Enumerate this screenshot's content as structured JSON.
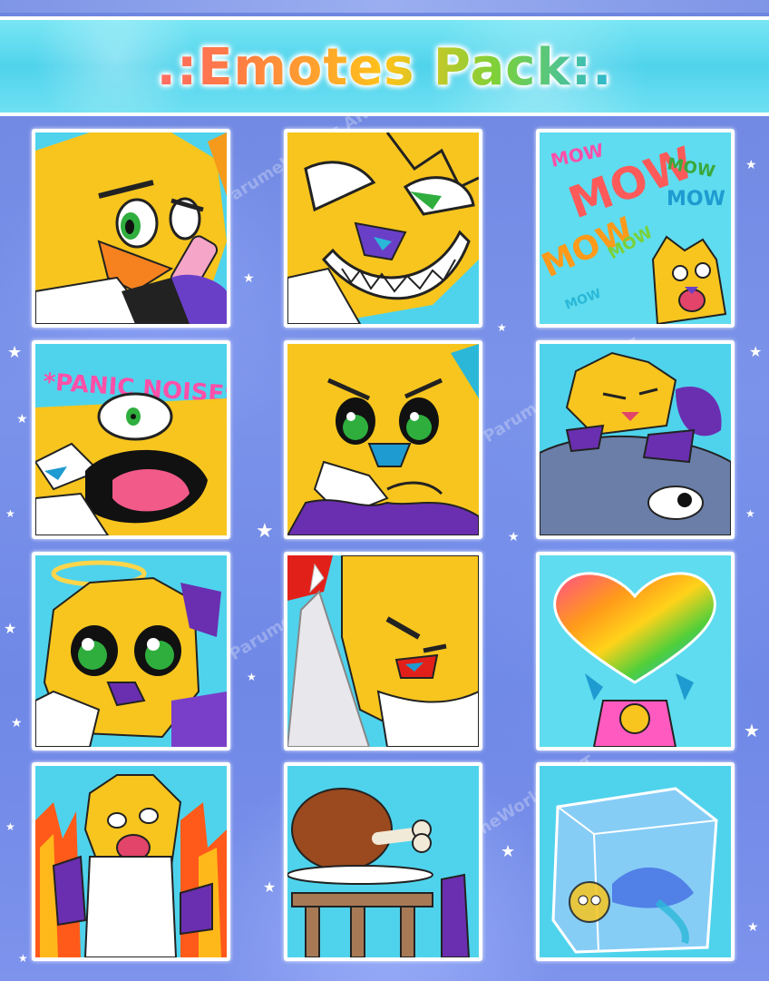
{
  "header": {
    "title": ".:Emotes Pack:."
  },
  "watermark": {
    "text": "ParumeWorld's ART"
  },
  "emotes": [
    {
      "row": 1,
      "col": 1,
      "caption": ""
    },
    {
      "row": 1,
      "col": 2,
      "caption": ""
    },
    {
      "row": 1,
      "col": 3,
      "caption": "MOW"
    },
    {
      "row": 2,
      "col": 1,
      "caption": "*PANIC NOISES*"
    },
    {
      "row": 2,
      "col": 2,
      "caption": ""
    },
    {
      "row": 2,
      "col": 3,
      "caption": ""
    },
    {
      "row": 3,
      "col": 1,
      "caption": ""
    },
    {
      "row": 3,
      "col": 2,
      "caption": ""
    },
    {
      "row": 3,
      "col": 3,
      "caption": ""
    },
    {
      "row": 4,
      "col": 1,
      "caption": ""
    },
    {
      "row": 4,
      "col": 2,
      "caption": ""
    },
    {
      "row": 4,
      "col": 3,
      "caption": ""
    }
  ],
  "colors": {
    "banner": "#4fd3ec",
    "background": "#7b93ea",
    "fur_yellow": "#f7c51e",
    "tile_border": "#ffffff"
  }
}
